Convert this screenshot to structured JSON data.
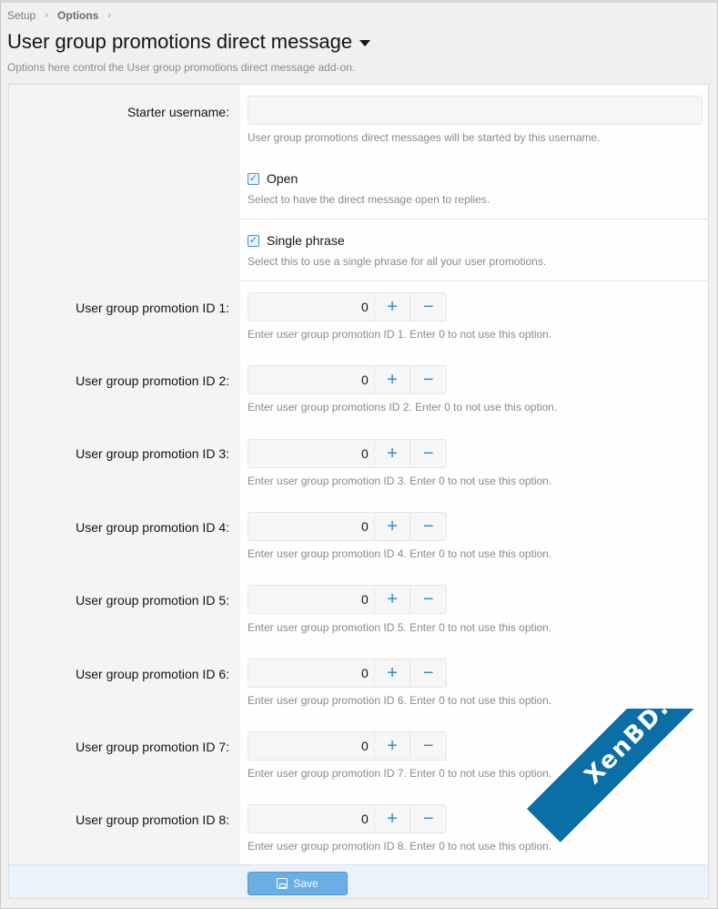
{
  "breadcrumb": [
    "Setup",
    "Options"
  ],
  "page": {
    "title": "User group promotions direct message",
    "description": "Options here control the User group promotions direct message add-on."
  },
  "starter": {
    "label": "Starter username:",
    "value": "",
    "hint": "User group promotions direct messages will be started by this username."
  },
  "open_option": {
    "label": "Open",
    "checked": true,
    "hint": "Select to have the direct message open to replies."
  },
  "single_phrase": {
    "label": "Single phrase",
    "checked": true,
    "hint": "Select this to use a single phrase for all your user promotions."
  },
  "promotions": [
    {
      "label": "User group promotion ID 1:",
      "value": "0",
      "hint": "Enter user group promotion ID 1. Enter 0 to not use this option."
    },
    {
      "label": "User group promotion ID 2:",
      "value": "0",
      "hint": "Enter user group promotions ID 2. Enter 0 to not use this option."
    },
    {
      "label": "User group promotion ID 3:",
      "value": "0",
      "hint": "Enter user group promotion ID 3. Enter 0 to not use this option."
    },
    {
      "label": "User group promotion ID 4:",
      "value": "0",
      "hint": "Enter user group promotion ID 4. Enter 0 to not use this option."
    },
    {
      "label": "User group promotion ID 5:",
      "value": "0",
      "hint": "Enter user group promotion ID 5. Enter 0 to not use this option."
    },
    {
      "label": "User group promotion ID 6:",
      "value": "0",
      "hint": "Enter user group promotion ID 6. Enter 0 to not use this option."
    },
    {
      "label": "User group promotion ID 7:",
      "value": "0",
      "hint": "Enter user group promotion ID 7. Enter 0 to not use this option."
    },
    {
      "label": "User group promotion ID 8:",
      "value": "0",
      "hint": "Enter user group promotion ID 8. Enter 0 to not use this option."
    }
  ],
  "stepper": {
    "plus": "+",
    "minus": "−"
  },
  "icons": {
    "checkbox": "check-icon",
    "breadcrumb_sep": "chevron-right-icon",
    "save": "save-icon",
    "title_menu": "caret-down-icon"
  },
  "footer": {
    "save_label": "Save"
  },
  "watermark": {
    "text": "XenBD.Com"
  },
  "colors": {
    "accent": "#2d8ccf",
    "save_button": "#6aaee4",
    "watermark": "#0b6fa6"
  }
}
